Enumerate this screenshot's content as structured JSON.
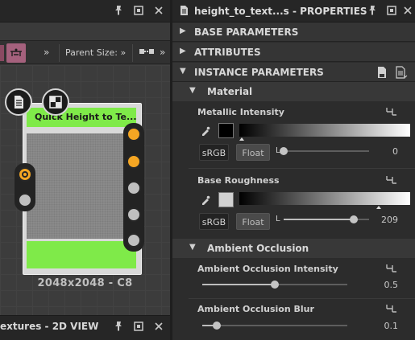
{
  "graph_panel": {
    "toolbar": {
      "chevron_1": "»",
      "chevron_2": "»",
      "parent_size_label": "Parent Size:",
      "chevron_3": "»"
    },
    "node": {
      "title": "Quick Height to Te...",
      "label": "2048x2048 - C8",
      "title_color": "#7fea49"
    }
  },
  "view_panel": {
    "title": "extures - 2D VIEW"
  },
  "properties": {
    "title": "height_to_text...s - PROPERTIES",
    "sections": {
      "base_parameters": "BASE PARAMETERS",
      "attributes": "ATTRIBUTES",
      "instance_parameters": "INSTANCE PARAMETERS"
    },
    "material": {
      "group_label": "Material",
      "metallic": {
        "label": "Metallic Intensity",
        "srgb": "sRGB",
        "float": "Float",
        "slider_letter": "L",
        "value": "0",
        "fraction": 0.0,
        "swatch_color": "#000000"
      },
      "roughness": {
        "label": "Base Roughness",
        "srgb": "sRGB",
        "float": "Float",
        "slider_letter": "L",
        "value": "209",
        "fraction": 0.82,
        "swatch_color": "#d1d1d1"
      }
    },
    "ambient_occlusion": {
      "group_label": "Ambient Occlusion",
      "intensity": {
        "label": "Ambient Occlusion Intensity",
        "value": "0.5",
        "fraction": 0.5
      },
      "blur": {
        "label": "Ambient Occlusion Blur",
        "value": "0.1",
        "fraction": 0.1
      }
    }
  },
  "icons": {
    "pin": "pin-icon",
    "restore": "restore-icon",
    "close": "close-icon",
    "document": "document-icon",
    "reset": "reset-parameter-icon",
    "color_picker": "eyedropper-icon"
  }
}
